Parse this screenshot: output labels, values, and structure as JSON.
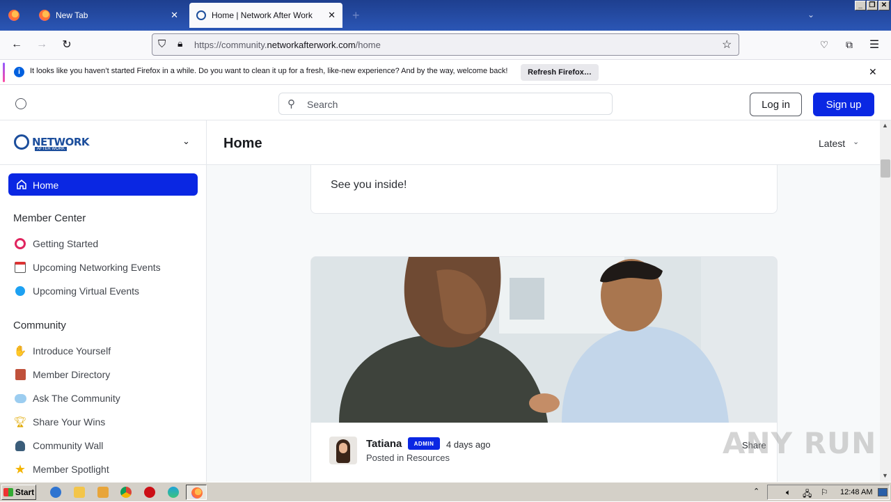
{
  "browser": {
    "tabs": [
      {
        "title": "New Tab",
        "active": false
      },
      {
        "title": "Home | Network After Work",
        "active": true
      }
    ],
    "url_prefix": "https://community.",
    "url_host": "networkafterwork.com",
    "url_path": "/home"
  },
  "notification": {
    "message": "It looks like you haven’t started Firefox in a while. Do you want to clean it up for a fresh, like-new experience? And by the way, welcome back!",
    "button": "Refresh Firefox…"
  },
  "site_header": {
    "search_placeholder": "Search",
    "login": "Log in",
    "signup": "Sign up"
  },
  "sidebar": {
    "brand_word": "NETWORK",
    "brand_sub": "AFTER WORK",
    "home": "Home",
    "sections": [
      {
        "title": "Member Center",
        "items": [
          {
            "label": "Getting Started",
            "icon": "target-icon"
          },
          {
            "label": "Upcoming Networking Events",
            "icon": "calendar-icon"
          },
          {
            "label": "Upcoming Virtual Events",
            "icon": "blue-circle-icon"
          }
        ]
      },
      {
        "title": "Community",
        "items": [
          {
            "label": "Introduce Yourself",
            "icon": "waving-hand-icon"
          },
          {
            "label": "Member Directory",
            "icon": "book-icon"
          },
          {
            "label": "Ask The Community",
            "icon": "speech-bubble-icon"
          },
          {
            "label": "Share Your Wins",
            "icon": "trophy-icon"
          },
          {
            "label": "Community Wall",
            "icon": "speaking-head-icon"
          },
          {
            "label": "Member Spotlight",
            "icon": "star-icon"
          }
        ]
      }
    ]
  },
  "main": {
    "title": "Home",
    "sort": "Latest",
    "card_text": "See you inside!",
    "post": {
      "author": "Tatiana",
      "badge": "ADMIN",
      "time": "4 days ago",
      "posted_in": "Posted in Resources",
      "share": "Share"
    }
  },
  "watermark": "ANY RUN",
  "taskbar": {
    "start": "Start",
    "clock": "12:48 AM"
  },
  "colors": {
    "brand_blue": "#0a27e3",
    "firefox_tabbar": "#2b56b5"
  }
}
